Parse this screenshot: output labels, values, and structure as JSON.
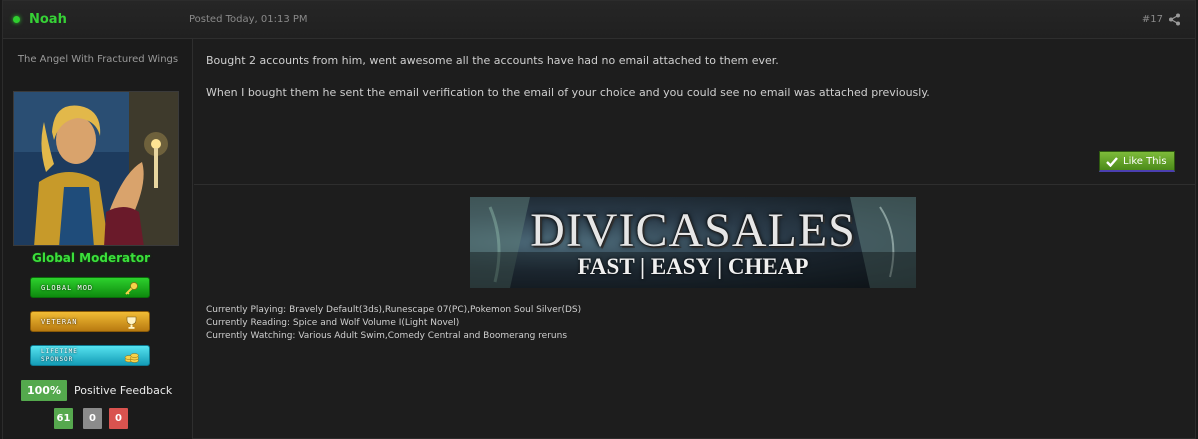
{
  "header": {
    "author": "Noah",
    "posted": "Posted Today, 01:13 PM",
    "post_number": "#17",
    "share_icon": "share-icon"
  },
  "author": {
    "title": "The Angel With Fractured Wings",
    "group": "Global Moderator",
    "badges": {
      "mod": "GLOBAL MOD",
      "veteran": "VETERAN",
      "sponsor_line1": "LIFETIME",
      "sponsor_line2": "SPONSOR"
    },
    "feedback": {
      "percent": "100%",
      "label": "Positive Feedback",
      "positive": "61",
      "neutral": "0",
      "negative": "0"
    }
  },
  "post": {
    "paragraph1": "Bought 2 accounts from him, went awesome all the accounts have had no email attached to them ever.",
    "paragraph2": "When I bought them he sent the email verification to the email of your choice and you could see no email was attached previously.",
    "like_label": "Like This"
  },
  "banner": {
    "title": "DIVICASALES",
    "subtitle": "FAST | EASY | CHEAP"
  },
  "signature": {
    "playing": "Currently Playing: Bravely Default(3ds),Runescape 07(PC),Pokemon Soul Silver(DS)",
    "reading": "Currently Reading: Spice and Wolf Volume I(Light Novel)",
    "watching": "Currently Watching: Various Adult Swim,Comedy Central and Boomerang reruns"
  },
  "colors": {
    "online": "#2fcf2f",
    "author_name": "#36d136",
    "group": "#3be03b",
    "feedback_positive": "#56a84e",
    "feedback_neutral": "#8b8b8b",
    "feedback_negative": "#d9534f"
  }
}
